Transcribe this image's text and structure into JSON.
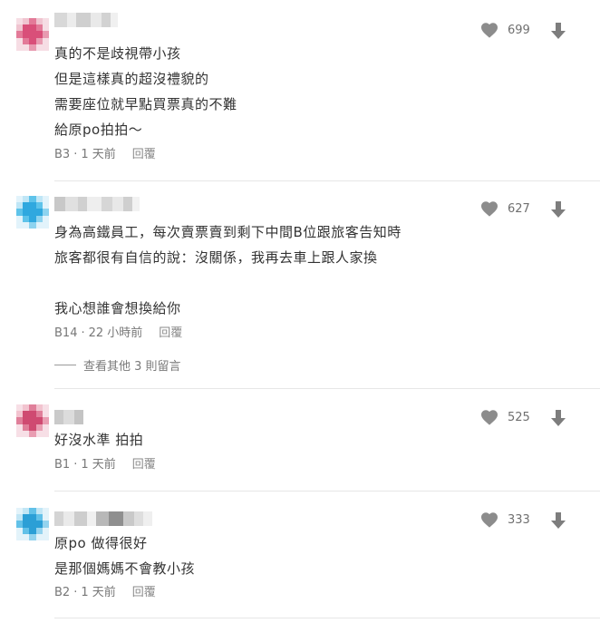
{
  "comments": [
    {
      "lines": [
        "真的不是歧視帶小孩",
        "但是這樣真的超沒禮貌的",
        "需要座位就早點買票真的不難",
        "給原po拍拍～"
      ],
      "floor": "B3",
      "time": "1 天前",
      "reply_label": "回覆",
      "likes": "699",
      "avatar_colors": [
        "#f0c4d0",
        "#e37a98",
        "#d94f79",
        "#e89ab0",
        "#f6dde4"
      ]
    },
    {
      "lines": [
        "身為高鐵員工，每次賣票賣到剩下中間B位跟旅客告知時",
        "旅客都很有自信的說：沒關係，我再去車上跟人家換",
        "",
        "我心想誰會想換給你"
      ],
      "floor": "B14",
      "time": "22 小時前",
      "reply_label": "回覆",
      "likes": "627",
      "more_replies": "查看其他 3 則留言",
      "avatar_colors": [
        "#bfe6f6",
        "#5ec3ea",
        "#2fa8df",
        "#8dd3ef",
        "#e2f3fb"
      ]
    },
    {
      "lines": [
        "好沒水準 拍拍"
      ],
      "floor": "B1",
      "time": "1 天前",
      "reply_label": "回覆",
      "likes": "525",
      "avatar_colors": [
        "#f2c3cf",
        "#e07f9a",
        "#cf4a71",
        "#e99db2",
        "#f7dfe6"
      ]
    },
    {
      "lines": [
        "原po 做得很好",
        "是那個媽媽不會教小孩"
      ],
      "floor": "B2",
      "time": "1 天前",
      "reply_label": "回覆",
      "likes": "333",
      "avatar_colors": [
        "#c2e6f5",
        "#62c1e8",
        "#2b9fd6",
        "#93d3ee",
        "#e3f3fa"
      ]
    }
  ]
}
